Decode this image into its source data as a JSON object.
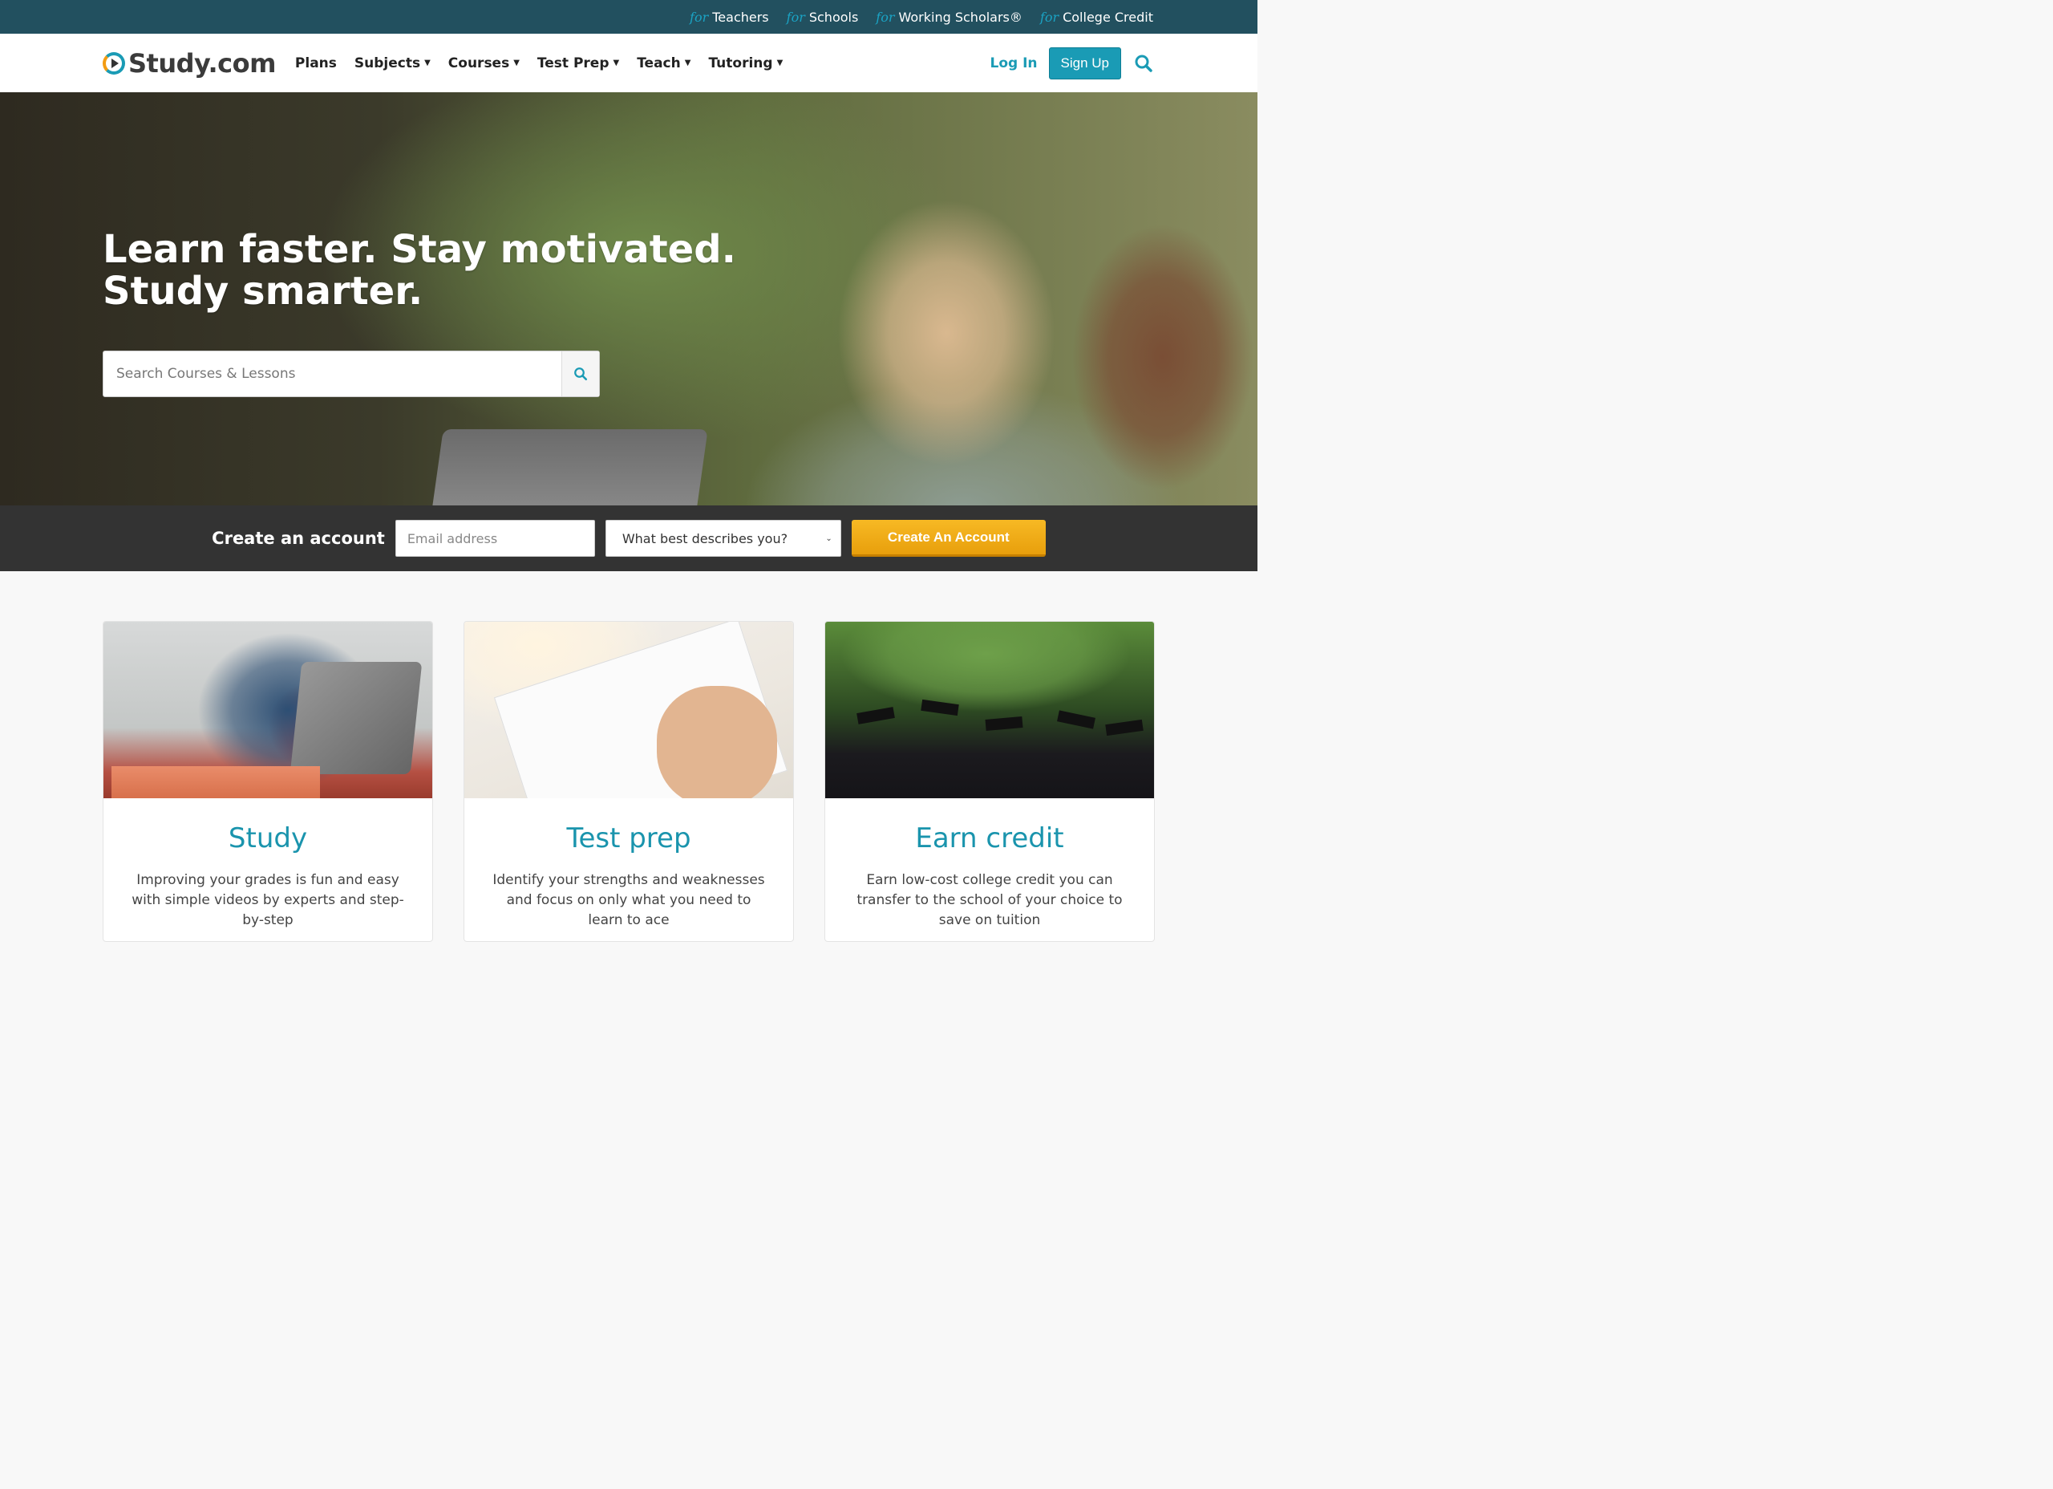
{
  "utility": {
    "for_word": "for",
    "links": [
      "Teachers",
      "Schools",
      "Working Scholars®",
      "College Credit"
    ]
  },
  "nav": {
    "logo_text": "Study.com",
    "items": [
      {
        "label": "Plans",
        "has_dropdown": false
      },
      {
        "label": "Subjects",
        "has_dropdown": true
      },
      {
        "label": "Courses",
        "has_dropdown": true
      },
      {
        "label": "Test Prep",
        "has_dropdown": true
      },
      {
        "label": "Teach",
        "has_dropdown": true
      },
      {
        "label": "Tutoring",
        "has_dropdown": true
      }
    ],
    "login_label": "Log In",
    "signup_label": "Sign Up",
    "search_icon": "search-icon"
  },
  "hero": {
    "headline_line1": "Learn faster. Stay motivated.",
    "headline_line2": "Study smarter.",
    "search_placeholder": "Search Courses & Lessons"
  },
  "account": {
    "label": "Create an account",
    "email_placeholder": "Email address",
    "select_value": "What best describes you?",
    "button_label": "Create An Account"
  },
  "features": [
    {
      "title": "Study",
      "description": "Improving your grades is fun and easy with simple videos by experts and step-by-step"
    },
    {
      "title": "Test prep",
      "description": "Identify your strengths and weaknesses and focus on only what you need to learn to ace"
    },
    {
      "title": "Earn credit",
      "description": "Earn low-cost college credit you can transfer to the school of your choice to save on tuition"
    }
  ],
  "colors": {
    "utility_bg": "#22505f",
    "accent": "#1a9bb5",
    "cta": "#f7b924",
    "account_bar": "#333333"
  }
}
